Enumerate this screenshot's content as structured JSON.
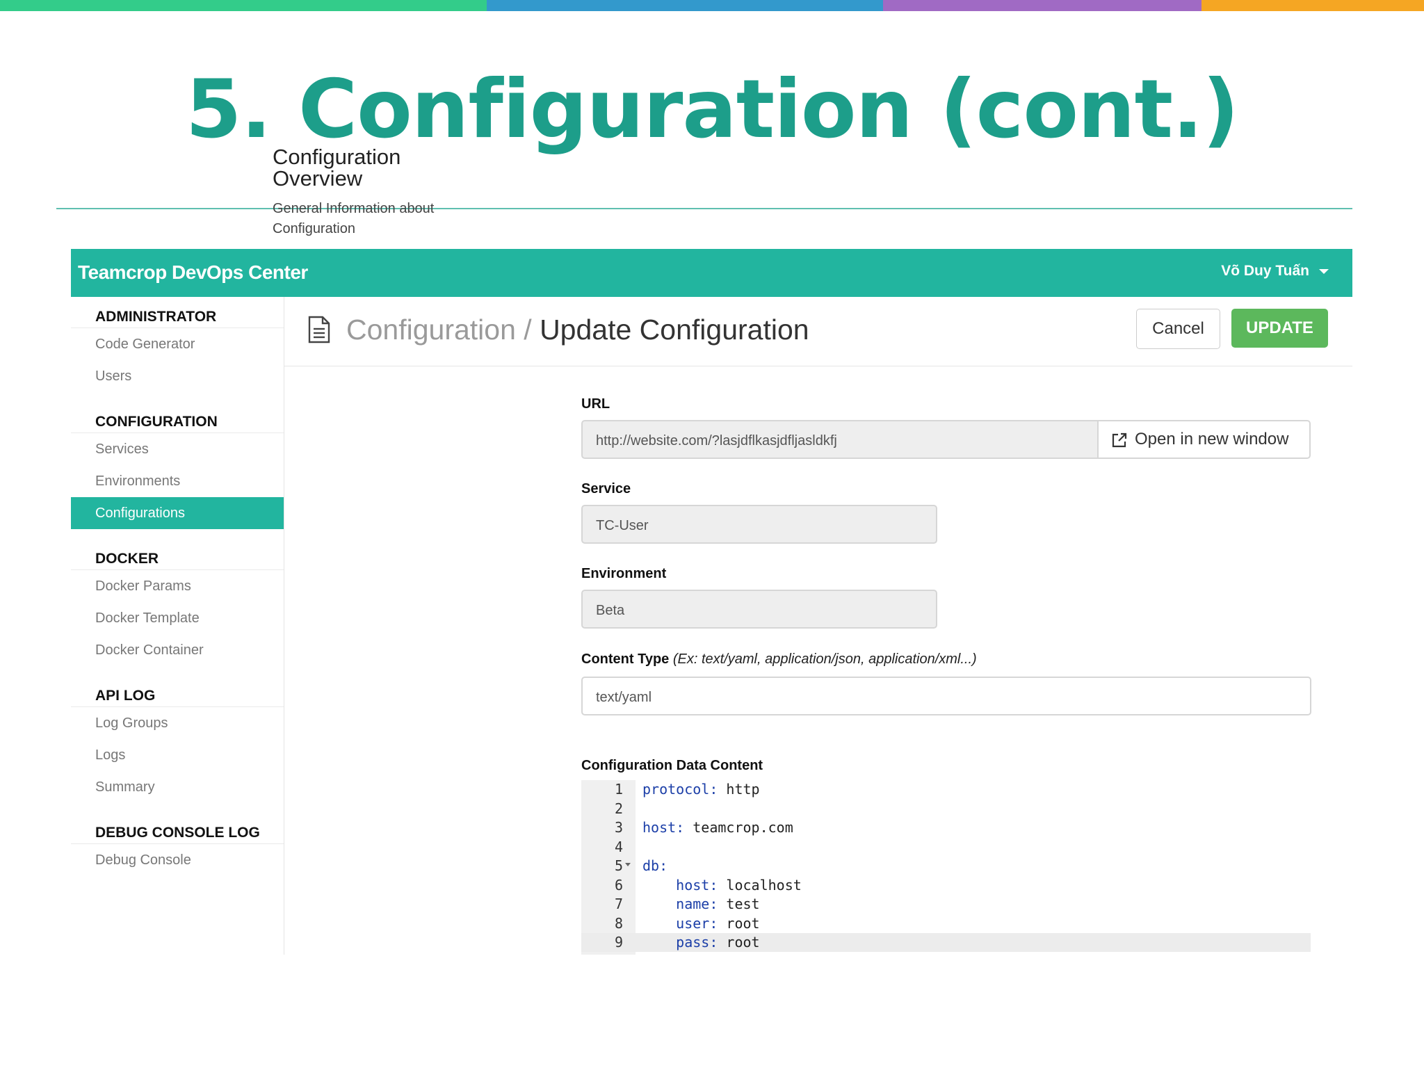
{
  "slide": {
    "title": "5. Configuration (cont.)",
    "top_bar_colors": [
      "#33cc8a",
      "#3399cc",
      "#a06ac4",
      "#f5a623"
    ]
  },
  "app": {
    "brand": "Teamcrop DevOps Center",
    "user": "Võ Duy Tuấn"
  },
  "sidebar": {
    "sections": [
      {
        "title": "ADMINISTRATOR",
        "items": [
          "Code Generator",
          "Users"
        ]
      },
      {
        "title": "CONFIGURATION",
        "items": [
          "Services",
          "Environments",
          "Configurations"
        ]
      },
      {
        "title": "DOCKER",
        "items": [
          "Docker Params",
          "Docker Template",
          "Docker Container"
        ]
      },
      {
        "title": "API LOG",
        "items": [
          "Log Groups",
          "Logs",
          "Summary"
        ]
      },
      {
        "title": "DEBUG CONSOLE LOG",
        "items": [
          "Debug Console"
        ]
      }
    ],
    "active_item": "Configurations"
  },
  "header": {
    "breadcrumb_parent": "Configuration",
    "breadcrumb_separator": " / ",
    "breadcrumb_current": "Update Configuration",
    "cancel_label": "Cancel",
    "update_label": "UPDATE"
  },
  "overview": {
    "title": "Configuration Overview",
    "description": "General Information about Configuration"
  },
  "form": {
    "url_label": "URL",
    "url_value": "http://website.com/?lasjdflkasjdfljasldkfj",
    "open_new_window_label": "Open in new window",
    "service_label": "Service",
    "service_value": "TC-User",
    "environment_label": "Environment",
    "environment_value": "Beta",
    "content_type_label": "Content Type",
    "content_type_hint": "(Ex: text/yaml, application/json, application/xml...)",
    "content_type_value": "text/yaml",
    "data_content_label": "Configuration Data Content"
  },
  "editor": {
    "lines": [
      {
        "num": "1",
        "key": "protocol:",
        "value": " http",
        "indent": ""
      },
      {
        "num": "2",
        "key": "",
        "value": "",
        "indent": ""
      },
      {
        "num": "3",
        "key": "host:",
        "value": " teamcrop.com",
        "indent": ""
      },
      {
        "num": "4",
        "key": "",
        "value": "",
        "indent": ""
      },
      {
        "num": "5",
        "key": "db:",
        "value": "",
        "indent": "",
        "foldable": true
      },
      {
        "num": "6",
        "key": "host:",
        "value": " localhost",
        "indent": "    "
      },
      {
        "num": "7",
        "key": "name:",
        "value": " test",
        "indent": "    "
      },
      {
        "num": "8",
        "key": "user:",
        "value": " root",
        "indent": "    "
      },
      {
        "num": "9",
        "key": "pass:",
        "value": " root",
        "indent": "    ",
        "current": true
      }
    ]
  }
}
